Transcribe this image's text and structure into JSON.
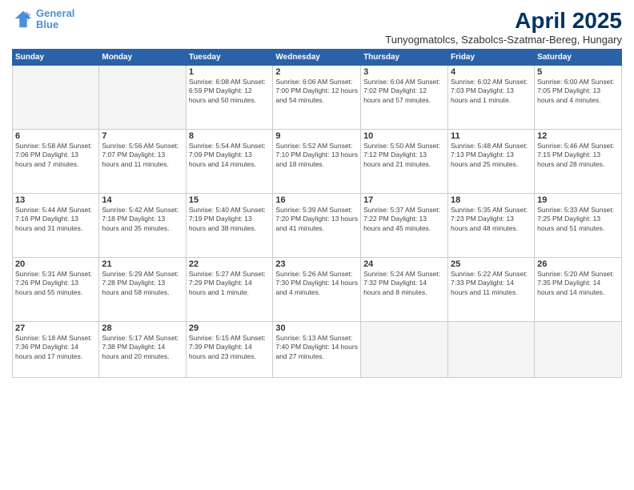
{
  "logo": {
    "line1": "General",
    "line2": "Blue"
  },
  "title": "April 2025",
  "subtitle": "Tunyogmatolcs, Szabolcs-Szatmar-Bereg, Hungary",
  "headers": [
    "Sunday",
    "Monday",
    "Tuesday",
    "Wednesday",
    "Thursday",
    "Friday",
    "Saturday"
  ],
  "weeks": [
    [
      {
        "day": "",
        "info": ""
      },
      {
        "day": "",
        "info": ""
      },
      {
        "day": "1",
        "info": "Sunrise: 6:08 AM\nSunset: 6:59 PM\nDaylight: 12 hours\nand 50 minutes."
      },
      {
        "day": "2",
        "info": "Sunrise: 6:06 AM\nSunset: 7:00 PM\nDaylight: 12 hours\nand 54 minutes."
      },
      {
        "day": "3",
        "info": "Sunrise: 6:04 AM\nSunset: 7:02 PM\nDaylight: 12 hours\nand 57 minutes."
      },
      {
        "day": "4",
        "info": "Sunrise: 6:02 AM\nSunset: 7:03 PM\nDaylight: 13 hours\nand 1 minute."
      },
      {
        "day": "5",
        "info": "Sunrise: 6:00 AM\nSunset: 7:05 PM\nDaylight: 13 hours\nand 4 minutes."
      }
    ],
    [
      {
        "day": "6",
        "info": "Sunrise: 5:58 AM\nSunset: 7:06 PM\nDaylight: 13 hours\nand 7 minutes."
      },
      {
        "day": "7",
        "info": "Sunrise: 5:56 AM\nSunset: 7:07 PM\nDaylight: 13 hours\nand 11 minutes."
      },
      {
        "day": "8",
        "info": "Sunrise: 5:54 AM\nSunset: 7:09 PM\nDaylight: 13 hours\nand 14 minutes."
      },
      {
        "day": "9",
        "info": "Sunrise: 5:52 AM\nSunset: 7:10 PM\nDaylight: 13 hours\nand 18 minutes."
      },
      {
        "day": "10",
        "info": "Sunrise: 5:50 AM\nSunset: 7:12 PM\nDaylight: 13 hours\nand 21 minutes."
      },
      {
        "day": "11",
        "info": "Sunrise: 5:48 AM\nSunset: 7:13 PM\nDaylight: 13 hours\nand 25 minutes."
      },
      {
        "day": "12",
        "info": "Sunrise: 5:46 AM\nSunset: 7:15 PM\nDaylight: 13 hours\nand 28 minutes."
      }
    ],
    [
      {
        "day": "13",
        "info": "Sunrise: 5:44 AM\nSunset: 7:16 PM\nDaylight: 13 hours\nand 31 minutes."
      },
      {
        "day": "14",
        "info": "Sunrise: 5:42 AM\nSunset: 7:18 PM\nDaylight: 13 hours\nand 35 minutes."
      },
      {
        "day": "15",
        "info": "Sunrise: 5:40 AM\nSunset: 7:19 PM\nDaylight: 13 hours\nand 38 minutes."
      },
      {
        "day": "16",
        "info": "Sunrise: 5:39 AM\nSunset: 7:20 PM\nDaylight: 13 hours\nand 41 minutes."
      },
      {
        "day": "17",
        "info": "Sunrise: 5:37 AM\nSunset: 7:22 PM\nDaylight: 13 hours\nand 45 minutes."
      },
      {
        "day": "18",
        "info": "Sunrise: 5:35 AM\nSunset: 7:23 PM\nDaylight: 13 hours\nand 48 minutes."
      },
      {
        "day": "19",
        "info": "Sunrise: 5:33 AM\nSunset: 7:25 PM\nDaylight: 13 hours\nand 51 minutes."
      }
    ],
    [
      {
        "day": "20",
        "info": "Sunrise: 5:31 AM\nSunset: 7:26 PM\nDaylight: 13 hours\nand 55 minutes."
      },
      {
        "day": "21",
        "info": "Sunrise: 5:29 AM\nSunset: 7:28 PM\nDaylight: 13 hours\nand 58 minutes."
      },
      {
        "day": "22",
        "info": "Sunrise: 5:27 AM\nSunset: 7:29 PM\nDaylight: 14 hours\nand 1 minute."
      },
      {
        "day": "23",
        "info": "Sunrise: 5:26 AM\nSunset: 7:30 PM\nDaylight: 14 hours\nand 4 minutes."
      },
      {
        "day": "24",
        "info": "Sunrise: 5:24 AM\nSunset: 7:32 PM\nDaylight: 14 hours\nand 8 minutes."
      },
      {
        "day": "25",
        "info": "Sunrise: 5:22 AM\nSunset: 7:33 PM\nDaylight: 14 hours\nand 11 minutes."
      },
      {
        "day": "26",
        "info": "Sunrise: 5:20 AM\nSunset: 7:35 PM\nDaylight: 14 hours\nand 14 minutes."
      }
    ],
    [
      {
        "day": "27",
        "info": "Sunrise: 5:18 AM\nSunset: 7:36 PM\nDaylight: 14 hours\nand 17 minutes."
      },
      {
        "day": "28",
        "info": "Sunrise: 5:17 AM\nSunset: 7:38 PM\nDaylight: 14 hours\nand 20 minutes."
      },
      {
        "day": "29",
        "info": "Sunrise: 5:15 AM\nSunset: 7:39 PM\nDaylight: 14 hours\nand 23 minutes."
      },
      {
        "day": "30",
        "info": "Sunrise: 5:13 AM\nSunset: 7:40 PM\nDaylight: 14 hours\nand 27 minutes."
      },
      {
        "day": "",
        "info": ""
      },
      {
        "day": "",
        "info": ""
      },
      {
        "day": "",
        "info": ""
      }
    ]
  ]
}
